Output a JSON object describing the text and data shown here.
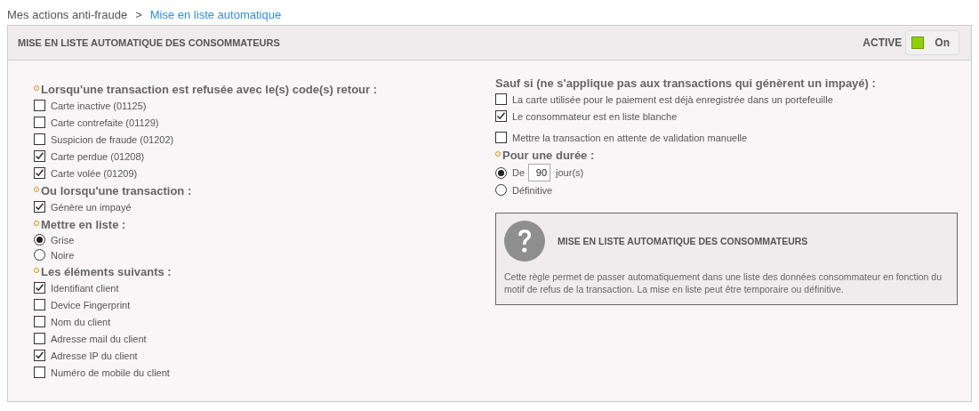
{
  "breadcrumb": [
    {
      "label": "Mes actions anti-fraude",
      "current": false
    },
    {
      "label": "Mise en liste automatique",
      "current": true
    }
  ],
  "breadcrumb_separator": ">",
  "panel": {
    "title": "MISE EN LISTE AUTOMATIQUE DES CONSOMMATEURS",
    "status_label": "ACTIVE",
    "toggle": {
      "label": "On",
      "on": true
    }
  },
  "left_sections": [
    {
      "heading": "Lorsqu'une transaction est refusée avec le(s) code(s) retour :",
      "required": true,
      "options": [
        {
          "kind": "checkbox",
          "label": "Carte inactive (01125)",
          "checked": false
        },
        {
          "kind": "checkbox",
          "label": "Carte contrefaite (01129)",
          "checked": false
        },
        {
          "kind": "checkbox",
          "label": "Suspicion de fraude (01202)",
          "checked": false
        },
        {
          "kind": "checkbox",
          "label": "Carte perdue (01208)",
          "checked": true
        },
        {
          "kind": "checkbox",
          "label": "Carte volée (01209)",
          "checked": true
        }
      ]
    },
    {
      "heading": "Ou lorsqu'une transaction :",
      "required": true,
      "options": [
        {
          "kind": "checkbox",
          "label": "Génère un impayé",
          "checked": true
        }
      ]
    },
    {
      "heading": "Mettre en liste :",
      "required": true,
      "options": [
        {
          "kind": "radio",
          "label": "Grise",
          "selected": true
        },
        {
          "kind": "radio",
          "label": "Noire",
          "selected": false
        }
      ]
    },
    {
      "heading": "Les éléments suivants :",
      "required": true,
      "options": [
        {
          "kind": "checkbox",
          "label": "Identifiant client",
          "checked": true
        },
        {
          "kind": "checkbox",
          "label": "Device Fingerprint",
          "checked": false
        },
        {
          "kind": "checkbox",
          "label": "Nom du client",
          "checked": false
        },
        {
          "kind": "checkbox",
          "label": "Adresse mail du client",
          "checked": false
        },
        {
          "kind": "checkbox",
          "label": "Adresse IP du client",
          "checked": true
        },
        {
          "kind": "checkbox",
          "label": "Numéro de mobile du client",
          "checked": false
        }
      ]
    }
  ],
  "right_sections": [
    {
      "heading": "Sauf si (ne s'applique pas aux transactions qui génèrent un impayé) :",
      "required": false,
      "options": [
        {
          "kind": "checkbox",
          "label": "La carte utilisée pour le paiement est déjà enregistrée dans un portefeuille",
          "checked": false
        },
        {
          "kind": "checkbox",
          "label": "Le consommateur est en liste blanche",
          "checked": true
        },
        {
          "kind": "checkbox",
          "label": "Mettre la transaction en attente de validation manuelle",
          "checked": false,
          "separated": true
        }
      ]
    },
    {
      "heading": "Pour une durée :",
      "required": true,
      "options": [
        {
          "kind": "radio_days",
          "label": "De",
          "value": "90",
          "unit": "jour(s)",
          "selected": true
        },
        {
          "kind": "radio",
          "label": "Définitive",
          "selected": false
        }
      ]
    }
  ],
  "info_box": {
    "title": "MISE EN LISTE AUTOMATIQUE DES CONSOMMATEURS",
    "text": "Cette règle permet de passer automatiquement dans une liste des données consommateur en fonction du motif de refus de la transaction. La mise en liste peut être temporaire ou définitive."
  }
}
